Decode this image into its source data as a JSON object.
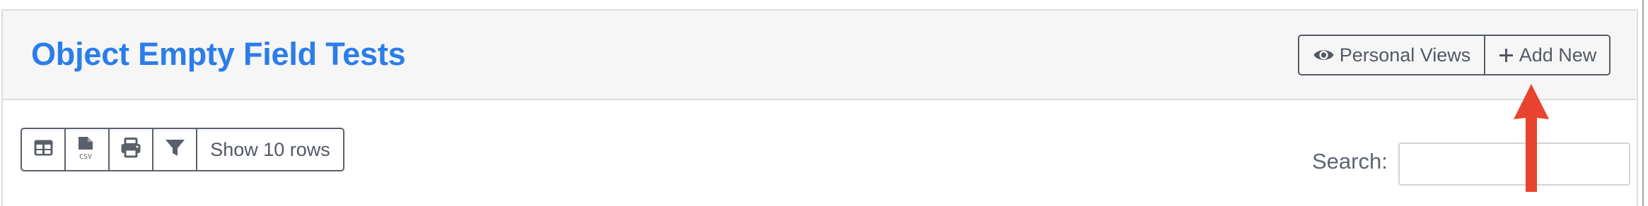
{
  "header": {
    "title": "Object Empty Field Tests",
    "personal_views_label": "Personal Views",
    "add_new_label": "Add New"
  },
  "toolbar": {
    "buttons": [
      {
        "name": "table-view",
        "icon": "table-icon"
      },
      {
        "name": "export-csv",
        "icon": "csv-file-icon"
      },
      {
        "name": "print",
        "icon": "printer-icon"
      },
      {
        "name": "filter",
        "icon": "filter-icon"
      }
    ],
    "show_rows_label": "Show 10 rows"
  },
  "search": {
    "label": "Search:",
    "value": "",
    "placeholder": ""
  },
  "annotation": {
    "type": "arrow",
    "color": "#e8432f",
    "points_to": "add-new-button"
  },
  "colors": {
    "title": "#2b7de9",
    "header_bg": "#f6f6f6",
    "button_text": "#525962"
  }
}
